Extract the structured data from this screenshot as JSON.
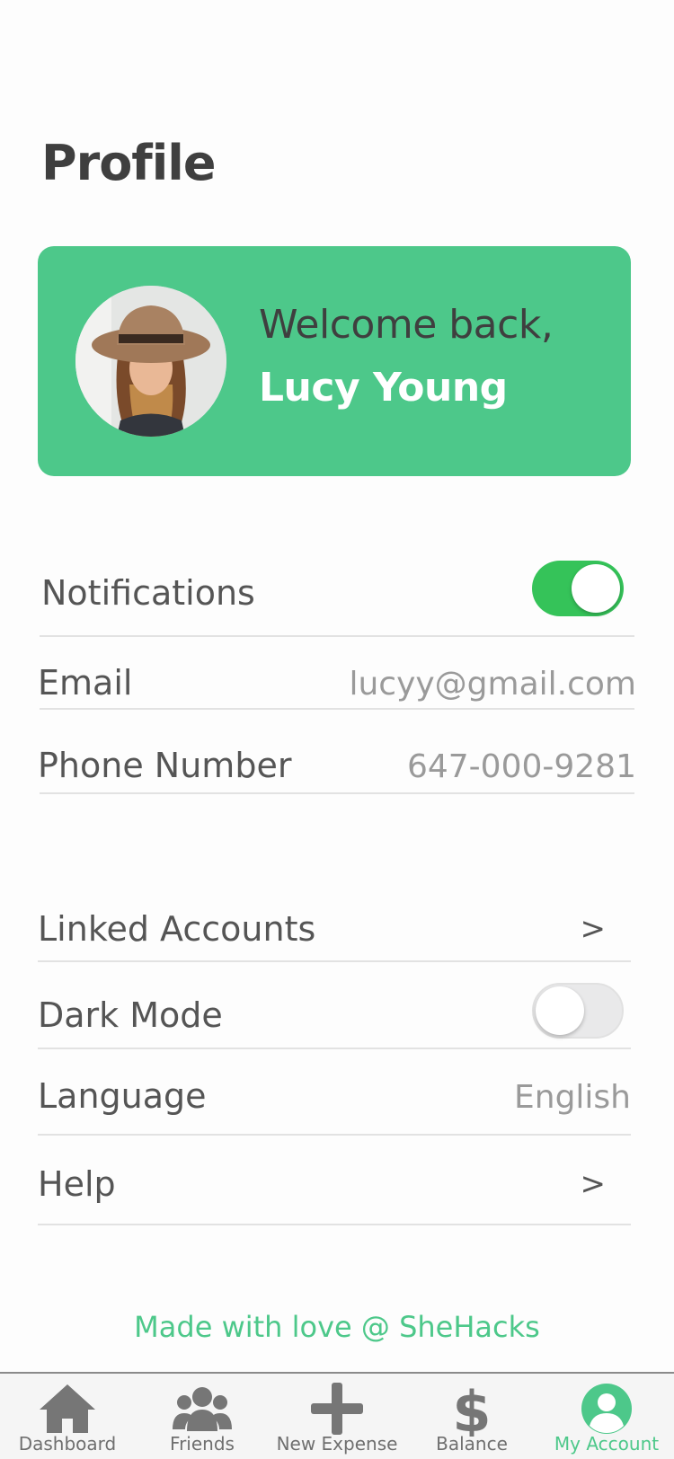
{
  "page": {
    "title": "Profile"
  },
  "welcome": {
    "greeting": "Welcome back,",
    "name": "Lucy Young"
  },
  "settings": {
    "notifications": {
      "label": "Notifications",
      "enabled": true
    },
    "email": {
      "label": "Email",
      "value": "lucyy@gmail.com"
    },
    "phone": {
      "label": "Phone Number",
      "value": "647-000-9281"
    },
    "linked_accounts": {
      "label": "Linked Accounts",
      "arrow": ">"
    },
    "dark_mode": {
      "label": "Dark Mode",
      "enabled": false
    },
    "language": {
      "label": "Language",
      "value": "English"
    },
    "help": {
      "label": "Help",
      "arrow": ">"
    }
  },
  "footer": {
    "note": "Made with love @ SheHacks"
  },
  "tabbar": {
    "items": [
      {
        "label": "Dashboard",
        "icon": "home-icon"
      },
      {
        "label": "Friends",
        "icon": "users-icon"
      },
      {
        "label": "New Expense",
        "icon": "plus-icon"
      },
      {
        "label": "Balance",
        "icon": "dollar-icon"
      },
      {
        "label": "My Account",
        "icon": "user-circle-icon",
        "active": true
      }
    ]
  },
  "colors": {
    "accent": "#4dc88a",
    "toggle_on": "#35c359",
    "text": "#4a4a4a",
    "muted": "#9a9a9a"
  }
}
